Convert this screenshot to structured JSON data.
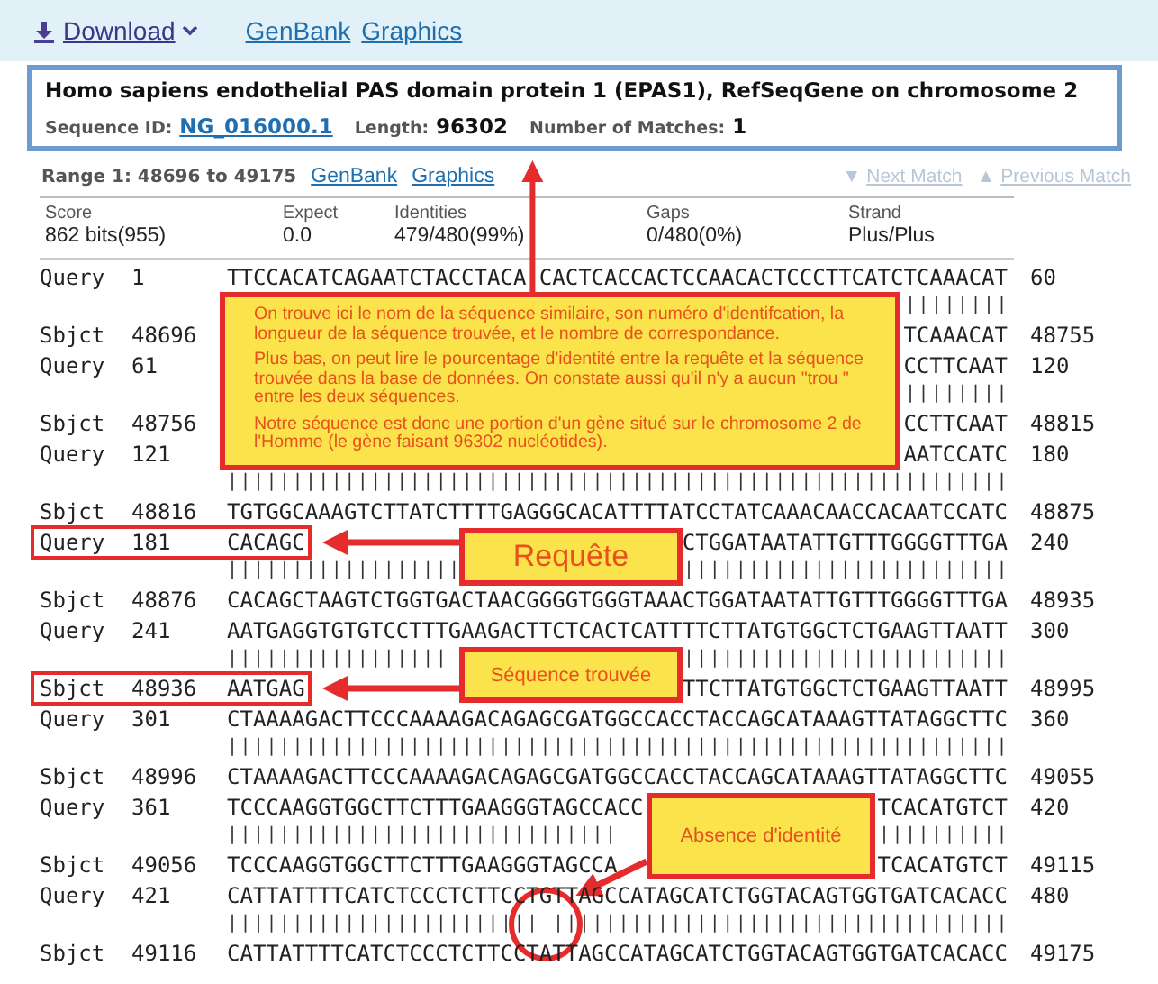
{
  "toolbar": {
    "download": "Download",
    "links": [
      "GenBank",
      "Graphics"
    ]
  },
  "hit": {
    "title": "Homo sapiens endothelial PAS domain protein 1 (EPAS1), RefSeqGene on chromosome 2",
    "sequence_id_label": "Sequence ID:",
    "sequence_id": "NG_016000.1",
    "length_label": "Length:",
    "length": "96302",
    "matches_label": "Number of Matches:",
    "matches": "1"
  },
  "range": {
    "label": "Range 1: 48696 to 49175",
    "links": [
      "GenBank",
      "Graphics"
    ],
    "nav": [
      {
        "arrow": "▼",
        "label": "Next Match",
        "disabled": true
      },
      {
        "arrow": "▲",
        "label": "Previous Match",
        "disabled": true
      }
    ]
  },
  "stats": [
    {
      "header": "Score",
      "value": "862 bits(955)"
    },
    {
      "header": "Expect",
      "value": "0.0"
    },
    {
      "header": "Identities",
      "value": "479/480(99%)"
    },
    {
      "header": "Gaps",
      "value": "0/480(0%)"
    },
    {
      "header": "Strand",
      "value": "Plus/Plus"
    }
  ],
  "alignment": [
    {
      "kind": "seq",
      "label": "Query",
      "start": "1",
      "seq": "TTCCACATCAGAATCTACCTACA CACTCACCACTCCAACACTCCCTTCATCTCAAACAT",
      "end": "60"
    },
    {
      "kind": "match",
      "bars": "                                                    ||||||||"
    },
    {
      "kind": "seq",
      "label": "Sbjct",
      "start": "48696",
      "seq": "                                                    TCAAACAT",
      "end": "48755"
    },
    {
      "kind": "seq",
      "label": "Query",
      "start": "61",
      "seq": "                                                    CCTTCAAT",
      "end": "120"
    },
    {
      "kind": "match",
      "bars": "                                                    ||||||||"
    },
    {
      "kind": "seq",
      "label": "Sbjct",
      "start": "48756",
      "seq": "                                                    CCTTCAAT",
      "end": "48815"
    },
    {
      "kind": "seq",
      "label": "Query",
      "start": "121",
      "seq": "                                                    AATCCATC",
      "end": "180"
    },
    {
      "kind": "match",
      "bars": "||||||||||||||||||||||||||||||||||||||||||||||||||||||||||||"
    },
    {
      "kind": "seq",
      "label": "Sbjct",
      "start": "48816",
      "seq": "TGTGGCAAAGTCTTATCTTTTGAGGGCACATTTTATCCTATCAAACAACCACAATCCATC",
      "end": "48875"
    },
    {
      "kind": "seq",
      "label": "Query",
      "start": "181",
      "seq": "CACAGC                             CTGGATAATATTGTTTGGGGTTTGA",
      "end": "240"
    },
    {
      "kind": "match",
      "bars": "||||||||||||||||||                 |||||||||||||||||||||||||"
    },
    {
      "kind": "seq",
      "label": "Sbjct",
      "start": "48876",
      "seq": "CACAGCTAAGTCTGGTGACTAACGGGGTGGGTAAACTGGATAATATTGTTTGGGGTTTGA",
      "end": "48935"
    },
    {
      "kind": "seq",
      "label": "Query",
      "start": "241",
      "seq": "AATGAGGTGTGTCCTTTGAAGACTTCTCACTCATTTTCTTATGTGGCTCTGAAGTTAATT",
      "end": "300"
    },
    {
      "kind": "match",
      "bars": "|||||||||||||||||                  |||||||||||||||||||||||||"
    },
    {
      "kind": "seq",
      "label": "Sbjct",
      "start": "48936",
      "seq": "AATGAG                             TTCTTATGTGGCTCTGAAGTTAATT",
      "end": "48995"
    },
    {
      "kind": "seq",
      "label": "Query",
      "start": "301",
      "seq": "CTAAAAGACTTCCCAAAAGACAGAGCGATGGCCACCTACCAGCATAAAGTTATAGGCTTC",
      "end": "360"
    },
    {
      "kind": "match",
      "bars": "||||||||||||||||||||||||||||||||||||||||||||||||||||||||||||"
    },
    {
      "kind": "seq",
      "label": "Sbjct",
      "start": "48996",
      "seq": "CTAAAAGACTTCCCAAAAGACAGAGCGATGGCCACCTACCAGCATAAAGTTATAGGCTTC",
      "end": "49055"
    },
    {
      "kind": "seq",
      "label": "Query",
      "start": "361",
      "seq": "TCCCAAGGTGGCTTCTTTGAAGGGTAGCCACC                  TCACATGTCT",
      "end": "420"
    },
    {
      "kind": "match",
      "bars": "||||||||||||||||||||||||||||||                    ||||||||||"
    },
    {
      "kind": "seq",
      "label": "Sbjct",
      "start": "49056",
      "seq": "TCCCAAGGTGGCTTCTTTGAAGGGTAGCCA                    TCACATGTCT",
      "end": "49115"
    },
    {
      "kind": "seq",
      "label": "Query",
      "start": "421",
      "seq": "CATTATTTTCATCTCCCTCTTCCTGTTAGCCATAGCATCTGGTACAGTGGTGATCACACC",
      "end": "480"
    },
    {
      "kind": "match",
      "bars": "|||||||||||||||||||||||| |||||||||||||||||||||||||||||||||||"
    },
    {
      "kind": "seq",
      "label": "Sbjct",
      "start": "49116",
      "seq": "CATTATTTTCATCTCCCTCTTCCTATTAGCCATAGCATCTGGTACAGTGGTGATCACACC",
      "end": "49175"
    }
  ],
  "annotations": [
    {
      "kind": "note",
      "paragraphs": [
        "On trouve ici le nom de la séquence similaire, son numéro d'identifcation, la longueur de la séquence trouvée, et le nombre de correspondance.",
        "Plus bas, on peut lire le pourcentage d'identité entre la requête et la séquence trouvée dans la base de données. On constate aussi qu'il n'y a aucun \"trou \" entre les deux séquences.",
        "Notre séquence est donc une portion d'un gène situé sur le chromosome 2 de l'Homme (le gène faisant 96302 nucléotides)."
      ]
    },
    {
      "kind": "label",
      "text": "Requête"
    },
    {
      "kind": "label",
      "text": "Séquence trouvée"
    },
    {
      "kind": "label",
      "text": "Absence d'identité"
    }
  ]
}
